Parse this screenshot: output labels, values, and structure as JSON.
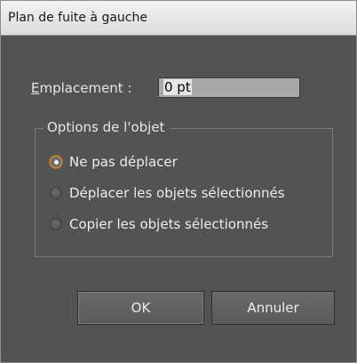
{
  "dialog": {
    "title": "Plan de fuite à gauche"
  },
  "placement": {
    "label_underlined_char": "E",
    "label_rest": "mplacement :",
    "value": "0 pt"
  },
  "object_options": {
    "legend": "Options de l'objet",
    "options": [
      {
        "label": "Ne pas déplacer",
        "selected": true
      },
      {
        "label": "Déplacer les objets sélectionnés",
        "selected": false
      },
      {
        "label": "Copier les objets sélectionnés",
        "selected": false
      }
    ]
  },
  "buttons": {
    "ok_label": "OK",
    "cancel_label": "Annuler"
  },
  "colors": {
    "panel_bg": "#535353",
    "focus_ring": "#f0a030",
    "field_bg": "#a9a9a9"
  }
}
